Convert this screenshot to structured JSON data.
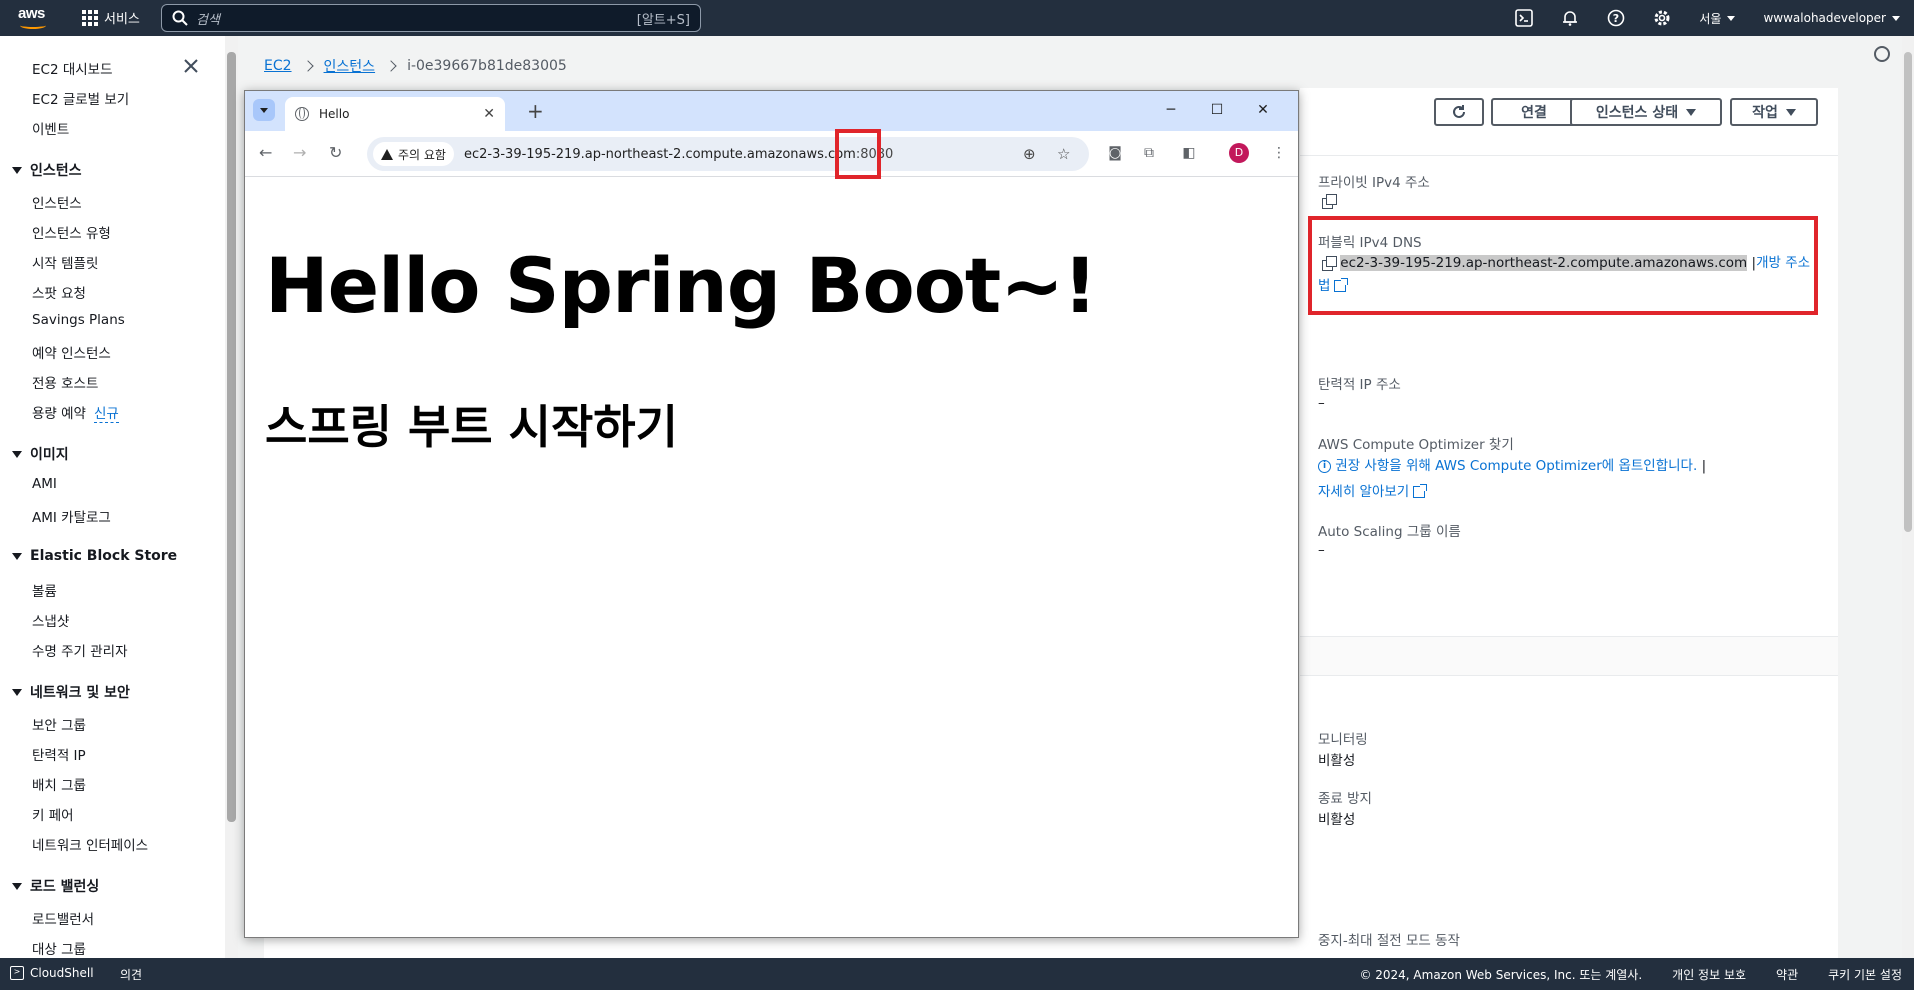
{
  "topnav": {
    "logo": "aws",
    "services_label": "서비스",
    "search_placeholder": "검색",
    "search_shortcut": "[알트+S]",
    "region": "서울",
    "account": "wwwalohadeveloper"
  },
  "sidebar": {
    "top_items": [
      "EC2 대시보드",
      "EC2 글로벌 보기",
      "이벤트"
    ],
    "sections": [
      {
        "title": "인스턴스",
        "items": [
          "인스턴스",
          "인스턴스 유형",
          "시작 템플릿",
          "스팟 요청",
          "Savings Plans",
          "예약 인스턴스",
          "전용 호스트",
          "용량 예약"
        ]
      },
      {
        "title": "이미지",
        "items": [
          "AMI",
          "AMI 카탈로그"
        ]
      },
      {
        "title": "Elastic Block Store",
        "items": [
          "볼륨",
          "스냅샷",
          "수명 주기 관리자"
        ]
      },
      {
        "title": "네트워크 및 보안",
        "items": [
          "보안 그룹",
          "탄력적 IP",
          "배치 그룹",
          "키 페어",
          "네트워크 인터페이스"
        ]
      },
      {
        "title": "로드 밸런싱",
        "items": [
          "로드밸런서",
          "대상 그룹"
        ]
      }
    ],
    "new_badge": "신규"
  },
  "breadcrumb": {
    "root": "EC2",
    "section": "인스턴스",
    "current": "i-0e39667b81de83005"
  },
  "actions": {
    "connect": "연결",
    "instance_state": "인스턴스 상태",
    "actions": "작업"
  },
  "details": {
    "private_ipv4_label": "프라이빗 IPv4 주소",
    "public_dns_label": "퍼블릭 IPv4 DNS",
    "public_dns_value": "ec2-3-39-195-219.ap-northeast-2.compute.amazonaws.com",
    "open_address_a": "개방 주소",
    "open_address_b": "법",
    "elastic_ip_label": "탄력적 IP 주소",
    "elastic_ip_value": "–",
    "optimizer_label": "AWS Compute Optimizer 찾기",
    "optimizer_link": "권장 사항을 위해 AWS Compute Optimizer에 옵트인합니다.",
    "learn_more": "자세히 알아보기",
    "asg_label": "Auto Scaling 그룹 이름",
    "asg_value": "–",
    "monitoring_label": "모니터링",
    "monitoring_value": "비활성",
    "termination_label": "종료 방지",
    "termination_value": "비활성",
    "stop_hibernate_label": "중지-최대 절전 모드 동작"
  },
  "browser": {
    "tab_title": "Hello",
    "security_chip": "주의 요함",
    "url_host": "ec2-3-39-195-219.ap-northeast-2.compute.amazonaws.com",
    "url_port": ":8080",
    "avatar_letter": "D",
    "heading": "Hello Spring Boot~!",
    "subheading": "스프링 부트 시작하기"
  },
  "footer": {
    "cloudshell": "CloudShell",
    "feedback": "의견",
    "copyright": "© 2024, Amazon Web Services, Inc. 또는 계열사.",
    "privacy": "개인 정보 보호",
    "terms": "약관",
    "cookies": "쿠키 기본 설정"
  },
  "colors": {
    "nav_bg": "#232f3e",
    "link": "#0972d3",
    "highlight_red": "#e0252b",
    "browser_frame": "#d3e3fd"
  }
}
